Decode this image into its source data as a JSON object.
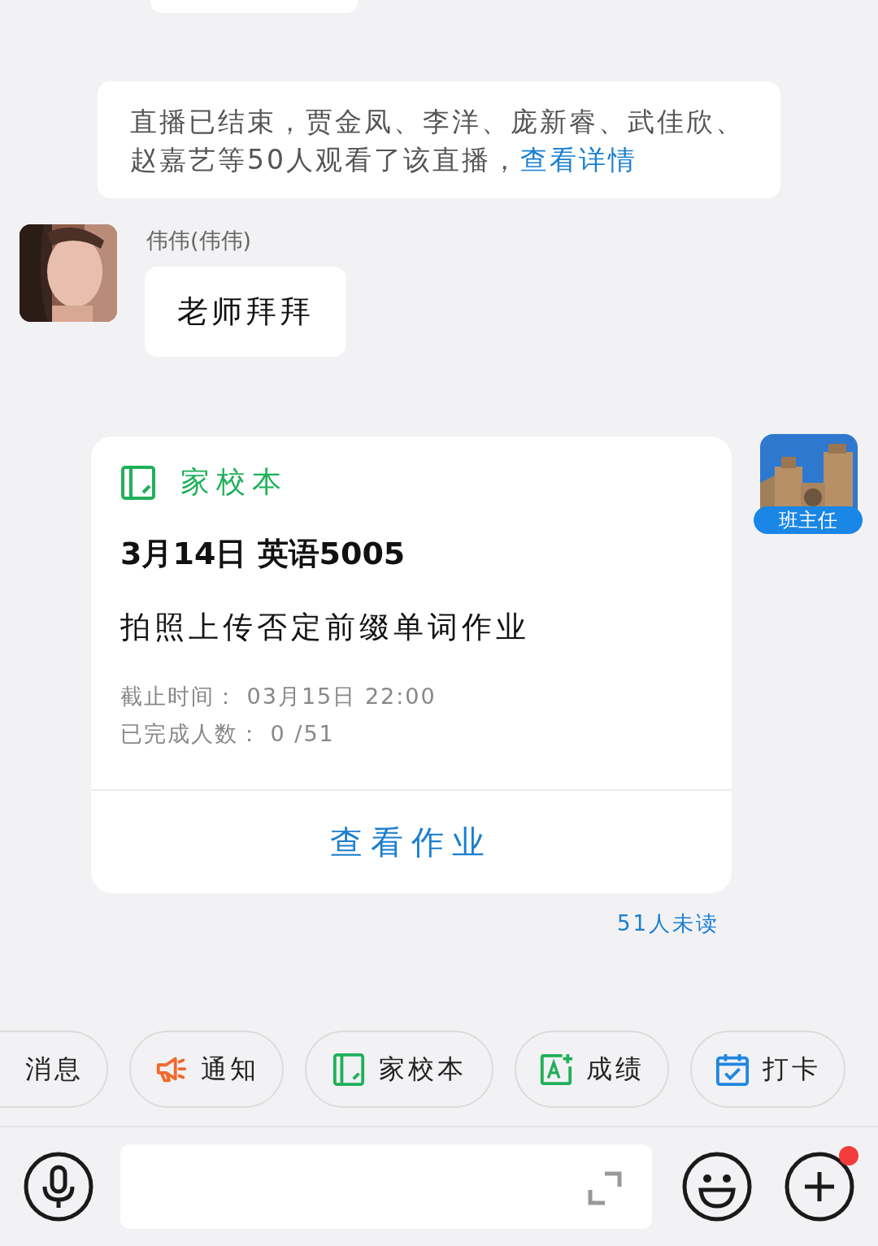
{
  "notice": {
    "text": "直播已结束，贾金凤、李洋、庞新睿、武佳欣、赵嘉艺等50人观看了该直播，",
    "link": "查看详情"
  },
  "message": {
    "sender": "伟伟(伟伟)",
    "text": "老师拜拜"
  },
  "homework_card": {
    "app_name": "家校本",
    "title": "3月14日 英语5005",
    "description": "拍照上传否定前缀单词作业",
    "details": [
      {
        "label": "截止时间：",
        "value": "03月15日 22:00"
      },
      {
        "label": "已完成人数：",
        "value": "0 /51"
      }
    ],
    "action": "查看作业",
    "sender_badge": "班主任",
    "read_status": "51人未读"
  },
  "quick_actions": [
    {
      "label": "消息",
      "kind": "plain"
    },
    {
      "label": "通知",
      "kind": "notice"
    },
    {
      "label": "家校本",
      "kind": "homework"
    },
    {
      "label": "成绩",
      "kind": "grade"
    },
    {
      "label": "打卡",
      "kind": "checkin"
    }
  ],
  "composer": {
    "plus_badge": true
  }
}
